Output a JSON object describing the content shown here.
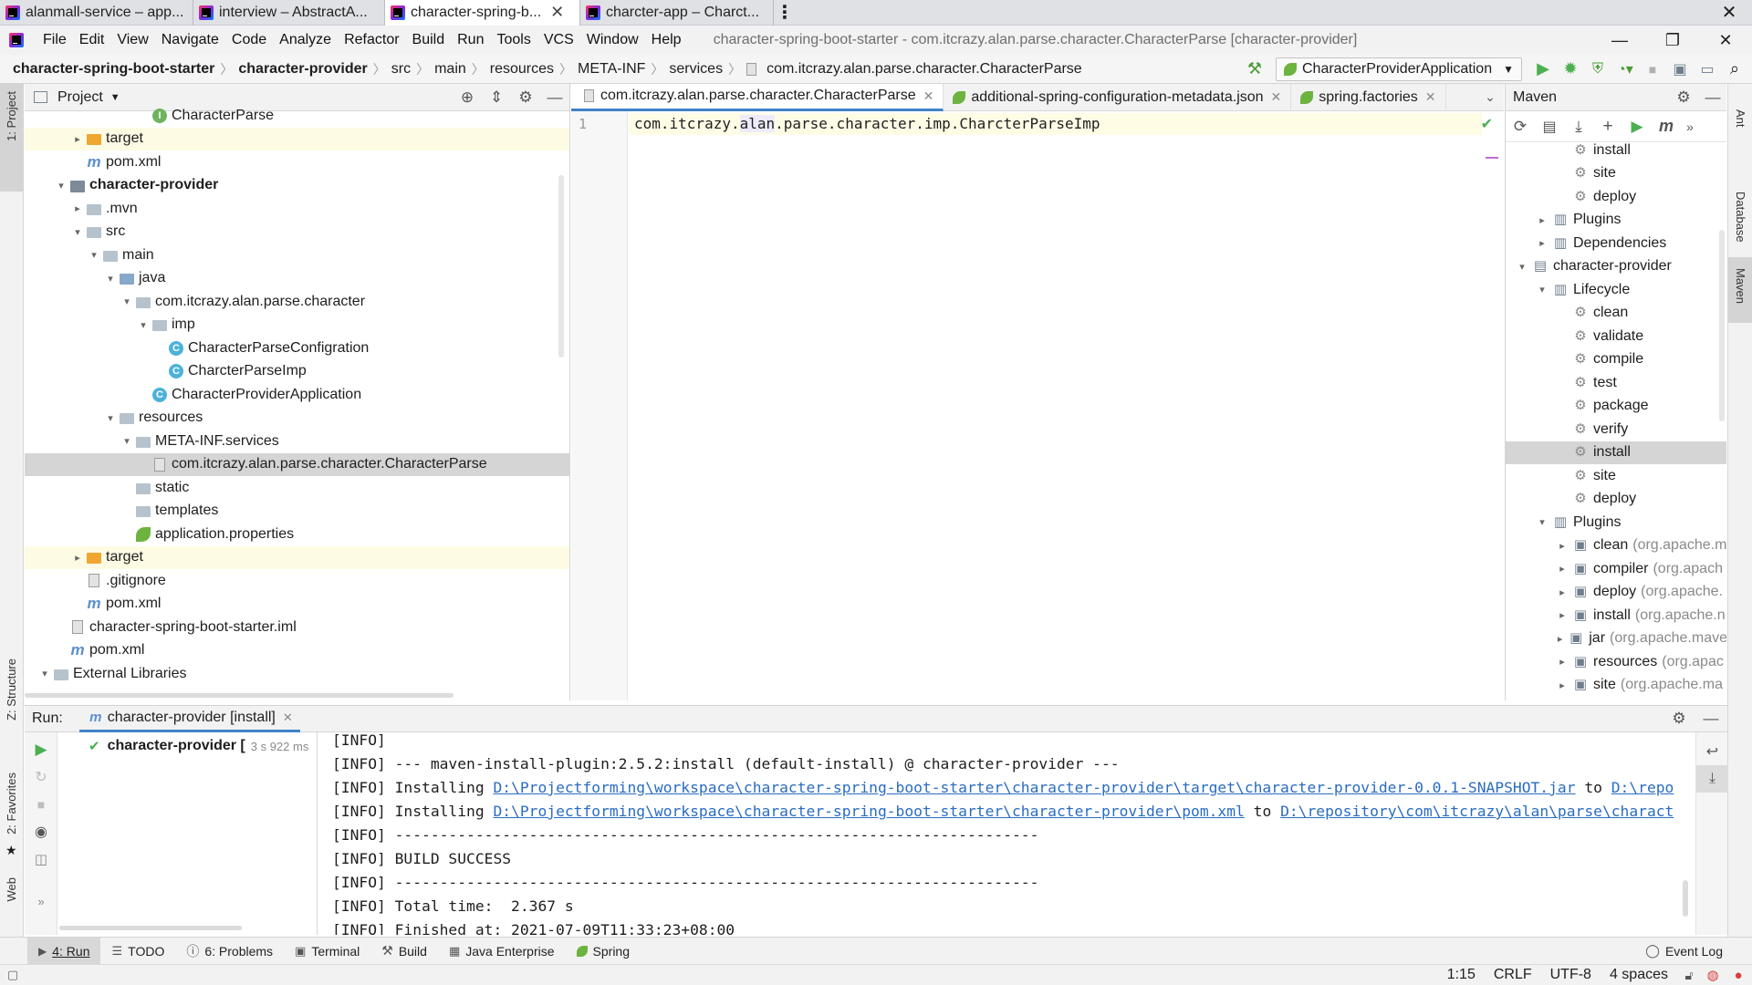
{
  "window_tabs": [
    {
      "label": "alanmall-service – app...",
      "active": false
    },
    {
      "label": "interview – AbstractA...",
      "active": false
    },
    {
      "label": "character-spring-b...",
      "active": true
    },
    {
      "label": "charcter-app – Charct...",
      "active": false
    }
  ],
  "menu": [
    "File",
    "Edit",
    "View",
    "Navigate",
    "Code",
    "Analyze",
    "Refactor",
    "Build",
    "Run",
    "Tools",
    "VCS",
    "Window",
    "Help"
  ],
  "window_title": "character-spring-boot-starter - com.itcrazy.alan.parse.character.CharacterParse [character-provider]",
  "breadcrumbs": [
    "character-spring-boot-starter",
    "character-provider",
    "src",
    "main",
    "resources",
    "META-INF",
    "services",
    "com.itcrazy.alan.parse.character.CharacterParse"
  ],
  "run_config": "CharacterProviderApplication",
  "left_stripe": {
    "project": "1: Project",
    "structure": "Z: Structure",
    "favorites": "2: Favorites",
    "web": "Web"
  },
  "right_stripe": {
    "ant": "Ant",
    "database": "Database",
    "maven": "Maven"
  },
  "project_panel": {
    "title": "Project",
    "tree": [
      {
        "label": "CharacterParse",
        "icon": "interface-icon",
        "indent": 7,
        "arrow": ""
      },
      {
        "label": "target",
        "icon": "folder-orange-icon",
        "indent": 3,
        "arrow": ">"
      },
      {
        "label": "pom.xml",
        "icon": "maven-icon",
        "indent": 3,
        "arrow": ""
      },
      {
        "label": "character-provider",
        "icon": "module-icon",
        "indent": 2,
        "arrow": "v",
        "bold": true
      },
      {
        "label": ".mvn",
        "icon": "folder-icon",
        "indent": 3,
        "arrow": ">"
      },
      {
        "label": "src",
        "icon": "folder-icon",
        "indent": 3,
        "arrow": "v"
      },
      {
        "label": "main",
        "icon": "folder-icon",
        "indent": 4,
        "arrow": "v"
      },
      {
        "label": "java",
        "icon": "folder-blue-icon",
        "indent": 5,
        "arrow": "v"
      },
      {
        "label": "com.itcrazy.alan.parse.character",
        "icon": "package-icon",
        "indent": 6,
        "arrow": "v"
      },
      {
        "label": "imp",
        "icon": "package-icon",
        "indent": 7,
        "arrow": "v"
      },
      {
        "label": "CharacterParseConfigration",
        "icon": "class-icon",
        "indent": 8,
        "arrow": ""
      },
      {
        "label": "CharcterParseImp",
        "icon": "class-icon",
        "indent": 8,
        "arrow": ""
      },
      {
        "label": "CharacterProviderApplication",
        "icon": "spring-class-icon",
        "indent": 7,
        "arrow": ""
      },
      {
        "label": "resources",
        "icon": "folder-icon",
        "indent": 5,
        "arrow": "v"
      },
      {
        "label": "META-INF.services",
        "icon": "folder-icon",
        "indent": 6,
        "arrow": "v"
      },
      {
        "label": "com.itcrazy.alan.parse.character.CharacterParse",
        "icon": "file-icon",
        "indent": 7,
        "arrow": "",
        "selected": true
      },
      {
        "label": "static",
        "icon": "folder-icon",
        "indent": 6,
        "arrow": ""
      },
      {
        "label": "templates",
        "icon": "folder-icon",
        "indent": 6,
        "arrow": ""
      },
      {
        "label": "application.properties",
        "icon": "spring-leaf-icon",
        "indent": 6,
        "arrow": ""
      },
      {
        "label": "target",
        "icon": "folder-orange-icon",
        "indent": 3,
        "arrow": ">"
      },
      {
        "label": ".gitignore",
        "icon": "file-icon",
        "indent": 3,
        "arrow": ""
      },
      {
        "label": "pom.xml",
        "icon": "maven-icon",
        "indent": 3,
        "arrow": ""
      },
      {
        "label": "character-spring-boot-starter.iml",
        "icon": "file-icon",
        "indent": 2,
        "arrow": ""
      },
      {
        "label": "pom.xml",
        "icon": "maven-icon",
        "indent": 2,
        "arrow": ""
      },
      {
        "label": "External Libraries",
        "icon": "library-icon",
        "indent": 1,
        "arrow": "v"
      }
    ]
  },
  "editor": {
    "tabs": [
      {
        "label": "com.itcrazy.alan.parse.character.CharacterParse",
        "active": true
      },
      {
        "label": "additional-spring-configuration-metadata.json",
        "active": false
      },
      {
        "label": "spring.factories",
        "active": false
      }
    ],
    "line_number": "1",
    "code_prefix": "com.itcrazy.",
    "code_highlight": "alan",
    "code_suffix": ".parse.character.imp.CharcterParseImp"
  },
  "maven_panel": {
    "title": "Maven",
    "tree": [
      {
        "label": "install",
        "type": "goal",
        "indent": 3
      },
      {
        "label": "site",
        "type": "goal",
        "indent": 3
      },
      {
        "label": "deploy",
        "type": "goal",
        "indent": 3
      },
      {
        "label": "Plugins",
        "type": "folder",
        "indent": 2,
        "arrow": ">"
      },
      {
        "label": "Dependencies",
        "type": "folder",
        "indent": 2,
        "arrow": ">"
      },
      {
        "label": "character-provider",
        "type": "module",
        "indent": 1,
        "arrow": "v"
      },
      {
        "label": "Lifecycle",
        "type": "folder",
        "indent": 2,
        "arrow": "v"
      },
      {
        "label": "clean",
        "type": "goal",
        "indent": 3
      },
      {
        "label": "validate",
        "type": "goal",
        "indent": 3
      },
      {
        "label": "compile",
        "type": "goal",
        "indent": 3
      },
      {
        "label": "test",
        "type": "goal",
        "indent": 3
      },
      {
        "label": "package",
        "type": "goal",
        "indent": 3
      },
      {
        "label": "verify",
        "type": "goal",
        "indent": 3
      },
      {
        "label": "install",
        "type": "goal",
        "indent": 3,
        "selected": true
      },
      {
        "label": "site",
        "type": "goal",
        "indent": 3
      },
      {
        "label": "deploy",
        "type": "goal",
        "indent": 3
      },
      {
        "label": "Plugins",
        "type": "folder",
        "indent": 2,
        "arrow": "v"
      },
      {
        "label": "clean",
        "suffix": "(org.apache.m",
        "type": "plugin",
        "indent": 3,
        "arrow": ">"
      },
      {
        "label": "compiler",
        "suffix": "(org.apach",
        "type": "plugin",
        "indent": 3,
        "arrow": ">"
      },
      {
        "label": "deploy",
        "suffix": "(org.apache.",
        "type": "plugin",
        "indent": 3,
        "arrow": ">"
      },
      {
        "label": "install",
        "suffix": "(org.apache.n",
        "type": "plugin",
        "indent": 3,
        "arrow": ">"
      },
      {
        "label": "jar",
        "suffix": "(org.apache.mave",
        "type": "plugin",
        "indent": 3,
        "arrow": ">"
      },
      {
        "label": "resources",
        "suffix": "(org.apac",
        "type": "plugin",
        "indent": 3,
        "arrow": ">"
      },
      {
        "label": "site",
        "suffix": "(org.apache.ma",
        "type": "plugin",
        "indent": 3,
        "arrow": ">"
      }
    ]
  },
  "run_panel": {
    "label": "Run:",
    "tab": "character-provider [install]",
    "tree_item": "character-provider [",
    "tree_time": "3 s 922 ms",
    "console": [
      {
        "text": "[INFO]"
      },
      {
        "text": "[INFO] --- maven-install-plugin:2.5.2:install (default-install) @ character-provider ---"
      },
      {
        "text": "[INFO] Installing ",
        "link": "D:\\Projectforming\\workspace\\character-spring-boot-starter\\character-provider\\target\\character-provider-0.0.1-SNAPSHOT.jar",
        "mid": " to ",
        "link2": "D:\\repo"
      },
      {
        "text": "[INFO] Installing ",
        "link": "D:\\Projectforming\\workspace\\character-spring-boot-starter\\character-provider\\pom.xml",
        "mid": " to ",
        "link2": "D:\\repository\\com\\itcrazy\\alan\\parse\\charact"
      },
      {
        "text": "[INFO] ------------------------------------------------------------------------"
      },
      {
        "text": "[INFO] BUILD SUCCESS"
      },
      {
        "text": "[INFO] ------------------------------------------------------------------------"
      },
      {
        "text": "[INFO] Total time:  2.367 s"
      },
      {
        "text": "[INFO] Finished at: 2021-07-09T11:33:23+08:00"
      }
    ]
  },
  "bottom_tools": [
    {
      "label": "4: Run",
      "icon": "run-icon",
      "active": true
    },
    {
      "label": "TODO",
      "icon": "list-icon",
      "active": false
    },
    {
      "label": "6: Problems",
      "icon": "problems-icon",
      "active": false
    },
    {
      "label": "Terminal",
      "icon": "terminal-icon",
      "active": false
    },
    {
      "label": "Build",
      "icon": "hammer-icon",
      "active": false
    },
    {
      "label": "Java Enterprise",
      "icon": "java-enterprise-icon",
      "active": false
    },
    {
      "label": "Spring",
      "icon": "spring-icon",
      "active": false
    }
  ],
  "event_log": "Event Log",
  "status": {
    "position": "1:15",
    "line_sep": "CRLF",
    "encoding": "UTF-8",
    "indent": "4 spaces"
  },
  "colors": {
    "accent": "#4083c9",
    "run_green": "#4caf50",
    "link": "#2a6cc2",
    "selection": "#d5d5d5",
    "highlight_row": "#fdfbe3"
  }
}
